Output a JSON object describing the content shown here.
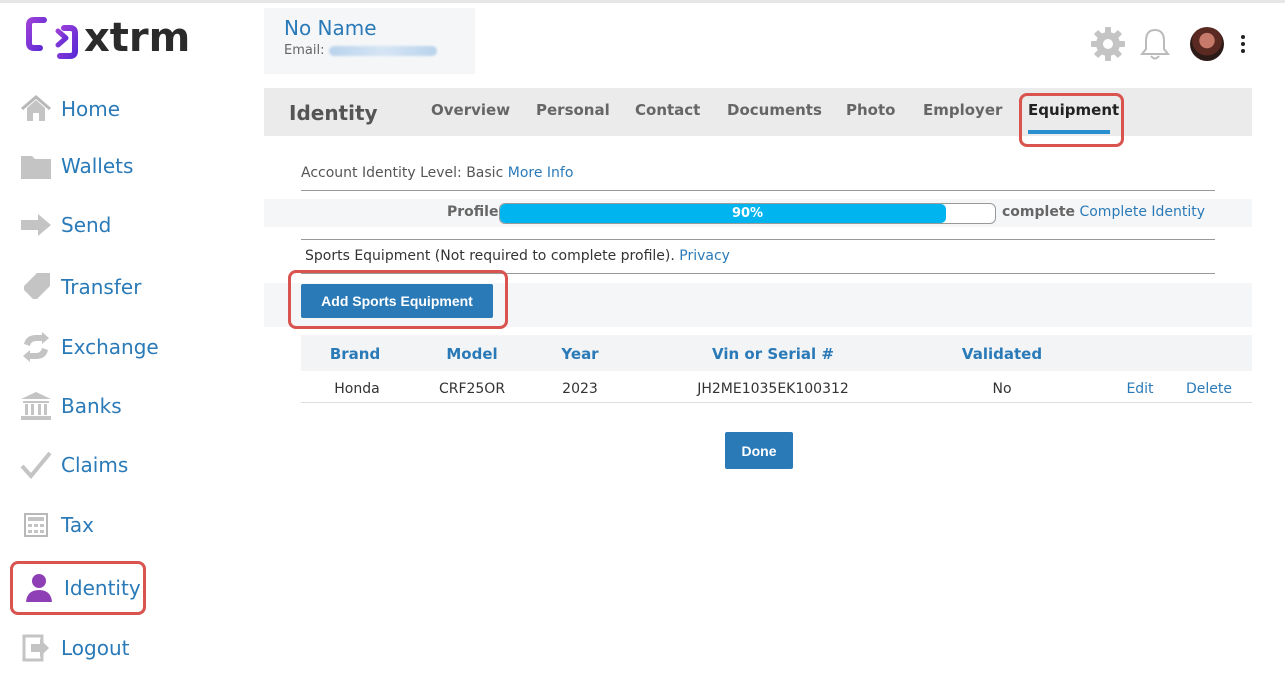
{
  "app": {
    "logo_text": "xtrm",
    "brand_color": "#7b35c9",
    "accent_color": "#2a7ab8",
    "highlight_color": "#d9534f"
  },
  "sidebar": {
    "items": [
      {
        "label": "Home",
        "icon": "home-icon"
      },
      {
        "label": "Wallets",
        "icon": "folder-icon"
      },
      {
        "label": "Send",
        "icon": "arrow-right-icon"
      },
      {
        "label": "Transfer",
        "icon": "transfer-icon"
      },
      {
        "label": "Exchange",
        "icon": "exchange-icon"
      },
      {
        "label": "Banks",
        "icon": "bank-icon"
      },
      {
        "label": "Claims",
        "icon": "checkmark-icon"
      },
      {
        "label": "Tax",
        "icon": "calculator-icon"
      },
      {
        "label": "Identity",
        "icon": "user-icon",
        "active": true
      },
      {
        "label": "Logout",
        "icon": "logout-icon"
      }
    ]
  },
  "header": {
    "user_name": "No Name",
    "email_label": "Email:",
    "icons": [
      "gear-icon",
      "bell-icon",
      "avatar",
      "kebab-menu-icon"
    ]
  },
  "tabs": {
    "title": "Identity",
    "items": [
      {
        "label": "Overview"
      },
      {
        "label": "Personal"
      },
      {
        "label": "Contact"
      },
      {
        "label": "Documents"
      },
      {
        "label": "Photo"
      },
      {
        "label": "Employer"
      },
      {
        "label": "Equipment",
        "active": true
      }
    ]
  },
  "identity_level": {
    "label": "Account Identity Level: Basic",
    "link": "More Info"
  },
  "progress": {
    "label": "Profile",
    "percent": 90,
    "percent_text": "90%",
    "complete_label": "complete",
    "complete_link": "Complete Identity"
  },
  "sports_note": {
    "text": "Sports Equipment (Not required to complete profile).",
    "link": "Privacy"
  },
  "add_button": "Add Sports Equipment",
  "table": {
    "headers": [
      "Brand",
      "Model",
      "Year",
      "Vin or Serial #",
      "Validated"
    ],
    "rows": [
      {
        "brand": "Honda",
        "model": "CRF25OR",
        "year": "2023",
        "vin": "JH2ME1035EK100312",
        "validated": "No",
        "edit": "Edit",
        "delete": "Delete"
      }
    ]
  },
  "done_button": "Done"
}
